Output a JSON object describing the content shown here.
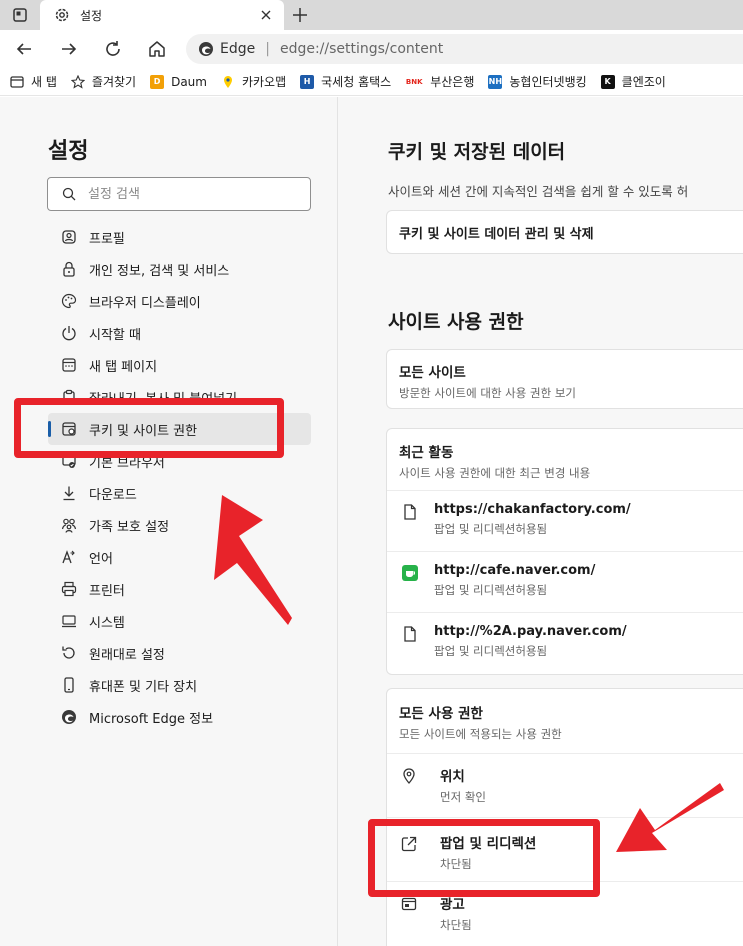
{
  "tab": {
    "title": "설정"
  },
  "toolbar": {
    "site_name": "Edge",
    "url": "edge://settings/content"
  },
  "favorites": [
    {
      "label": "새 탭",
      "icon": "newtab-icon",
      "color": "#555555"
    },
    {
      "label": "즐겨찾기",
      "icon": "star-icon",
      "color": "#555555"
    },
    {
      "label": "Daum",
      "icon": "daum-icon",
      "color": "#f2a007"
    },
    {
      "label": "카카오맵",
      "icon": "kakaomap-icon",
      "color": "#ffcd00"
    },
    {
      "label": "국세청 홈택스",
      "icon": "hometax-icon",
      "color": "#1e5aa8"
    },
    {
      "label": "부산은행",
      "icon": "bnk-icon",
      "color": "#e3241b"
    },
    {
      "label": "농협인터넷뱅킹",
      "icon": "nh-icon",
      "color": "#1c6fc1"
    },
    {
      "label": "클엔조이",
      "icon": "clenjoy-icon",
      "color": "#111111"
    }
  ],
  "sidebar": {
    "title": "설정",
    "search_placeholder": "설정 검색",
    "items": [
      {
        "label": "프로필",
        "icon": "profile-icon"
      },
      {
        "label": "개인 정보, 검색 및 서비스",
        "icon": "lock-icon"
      },
      {
        "label": "브라우저 디스플레이",
        "icon": "palette-icon"
      },
      {
        "label": "시작할 때",
        "icon": "power-icon"
      },
      {
        "label": "새 탭 페이지",
        "icon": "newtab-page-icon"
      },
      {
        "label": "잘라내기, 복사 및 붙여넣기",
        "icon": "clipboard-icon"
      },
      {
        "label": "쿠키 및 사이트 권한",
        "icon": "cookie-icon",
        "active": true
      },
      {
        "label": "기본 브라우저",
        "icon": "default-browser-icon"
      },
      {
        "label": "다운로드",
        "icon": "download-icon"
      },
      {
        "label": "가족 보호 설정",
        "icon": "family-icon"
      },
      {
        "label": "언어",
        "icon": "language-icon"
      },
      {
        "label": "프린터",
        "icon": "printer-icon"
      },
      {
        "label": "시스템",
        "icon": "system-icon"
      },
      {
        "label": "원래대로 설정",
        "icon": "reset-icon"
      },
      {
        "label": "휴대폰 및 기타 장치",
        "icon": "phone-icon"
      },
      {
        "label": "Microsoft Edge 정보",
        "icon": "edge-icon"
      }
    ]
  },
  "content": {
    "cookies": {
      "heading": "쿠키 및 저장된 데이터",
      "description": "사이트와 세션 간에 지속적인 검색을 쉽게 할 수 있도록 허",
      "manage_label": "쿠키 및 사이트 데이터 관리 및 삭제"
    },
    "permissions": {
      "heading": "사이트 사용 권한",
      "all_sites": {
        "title": "모든 사이트",
        "subtitle": "방문한 사이트에 대한 사용 권한 보기"
      },
      "recent": {
        "title": "최근 활동",
        "subtitle": "사이트 사용 권한에 대한 최근 변경 내용",
        "items": [
          {
            "url": "https://chakanfactory.com/",
            "detail": "팝업 및 리디렉션허용됨",
            "icon": "page-icon"
          },
          {
            "url": "http://cafe.naver.com/",
            "detail": "팝업 및 리디렉션허용됨",
            "icon": "naver-cafe-icon"
          },
          {
            "url": "http://%2A.pay.naver.com/",
            "detail": "팝업 및 리디렉션허용됨",
            "icon": "page-icon"
          }
        ]
      },
      "all_permissions": {
        "title": "모든 사용 권한",
        "subtitle": "모든 사이트에 적용되는 사용 권한",
        "items": [
          {
            "title": "위치",
            "status": "먼저 확인",
            "icon": "location-icon"
          },
          {
            "title": "팝업 및 리디렉션",
            "status": "차단됨",
            "icon": "popup-icon"
          },
          {
            "title": "광고",
            "status": "차단됨",
            "icon": "ads-icon"
          }
        ]
      }
    }
  },
  "annotation_color": "#e8232a"
}
